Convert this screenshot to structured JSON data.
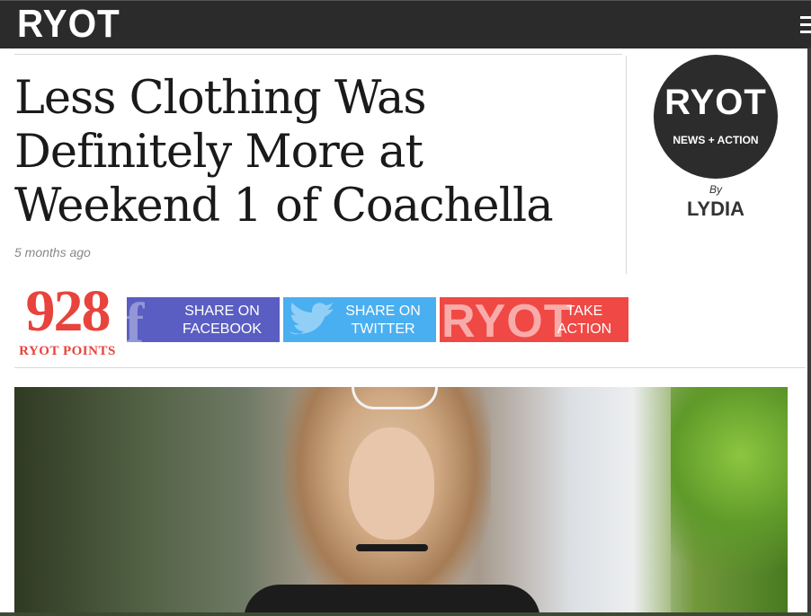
{
  "header": {
    "logo": "RYOT",
    "menu_icon": "hamburger-menu-icon"
  },
  "article": {
    "title": "Less Clothing Was Definitely More at Weekend 1 of Coachella",
    "time": "5 months ago"
  },
  "author": {
    "avatar_logo": "RYOT",
    "avatar_sub": "NEWS + ACTION",
    "by": "By",
    "name": "LYDIA"
  },
  "points": {
    "value": "928",
    "label": "RYOT POINTS"
  },
  "share": {
    "facebook": {
      "line1": "SHARE ON",
      "line2": "FACEBOOK",
      "glyph": "f",
      "color": "#5a5ec2"
    },
    "twitter": {
      "line1": "SHARE ON",
      "line2": "TWITTER",
      "glyph": "🐦",
      "color": "#4aaff0"
    },
    "action": {
      "line1": "TAKE",
      "line2": "ACTION",
      "glyph": "RYOT",
      "color": "#f04844"
    }
  },
  "colors": {
    "header_bg": "#2b2b2b",
    "points_red": "#e8433c"
  }
}
